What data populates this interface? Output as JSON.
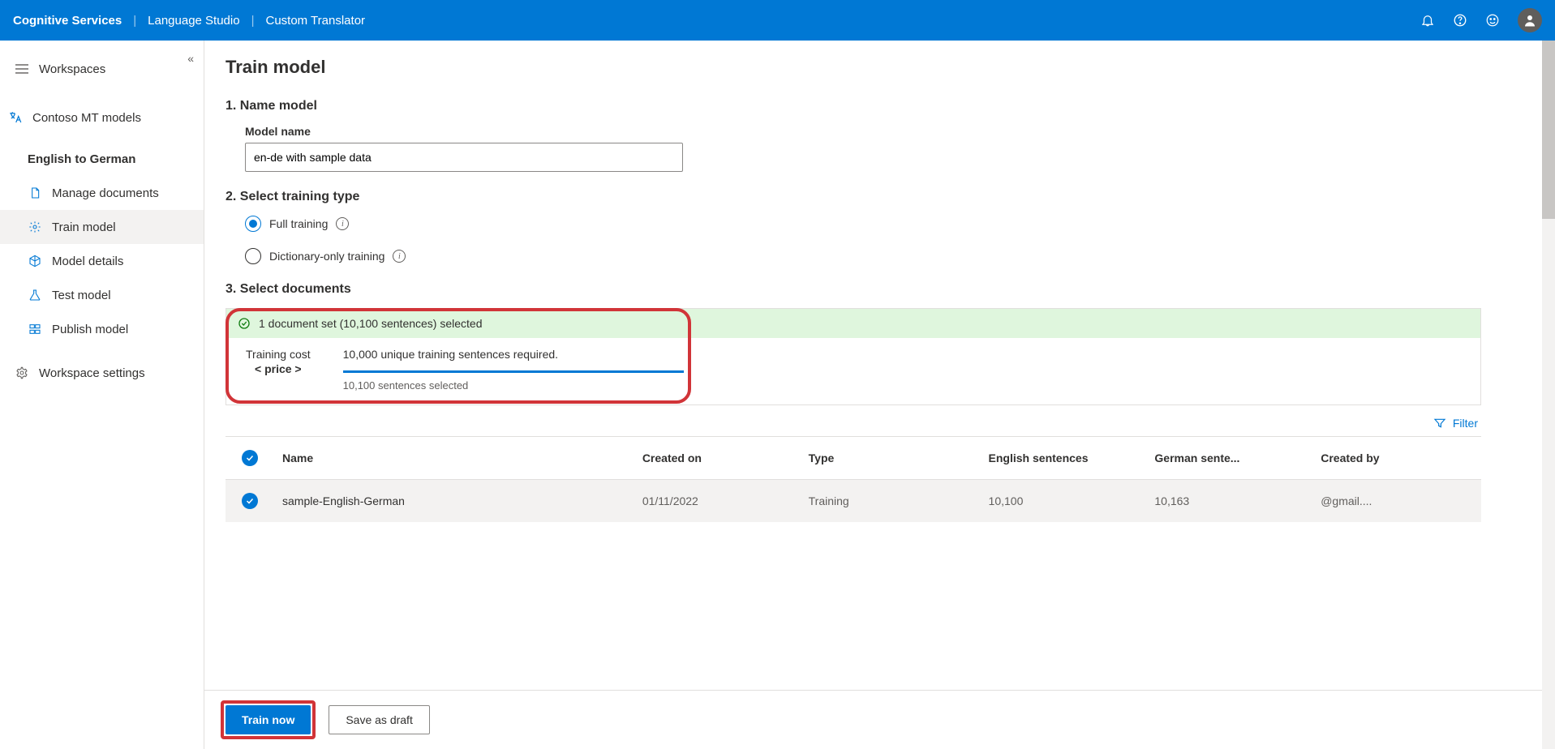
{
  "header": {
    "brand": "Cognitive Services",
    "crumb1": "Language Studio",
    "crumb2": "Custom Translator"
  },
  "sidebar": {
    "workspaces": "Workspaces",
    "workspace_name": "Contoso MT models",
    "project_name": "English to German",
    "manage_documents": "Manage documents",
    "train_model": "Train model",
    "model_details": "Model details",
    "test_model": "Test model",
    "publish_model": "Publish model",
    "workspace_settings": "Workspace settings"
  },
  "page": {
    "title": "Train model",
    "step1_heading": "1. Name model",
    "model_name_label": "Model name",
    "model_name_value": "en-de with sample data",
    "step2_heading": "2. Select training type",
    "radio_full": "Full training",
    "radio_dict": "Dictionary-only training",
    "step3_heading": "3. Select documents"
  },
  "summary": {
    "selected_text": "1 document set (10,100 sentences) selected",
    "training_cost_label": "Training cost",
    "price_label": "< price >",
    "required_text": "10,000 unique training sentences required.",
    "selected_count_text": "10,100 sentences selected"
  },
  "filter": {
    "label": "Filter"
  },
  "table": {
    "headers": {
      "name": "Name",
      "created_on": "Created on",
      "type": "Type",
      "english_sentences": "English sentences",
      "german_sentences": "German sente...",
      "created_by": "Created by"
    },
    "rows": [
      {
        "name": "sample-English-German",
        "created_on": "01/11/2022",
        "type": "Training",
        "english_sentences": "10,100",
        "german_sentences": "10,163",
        "created_by": "@gmail...."
      }
    ]
  },
  "footer": {
    "train_now": "Train now",
    "save_draft": "Save as draft"
  }
}
